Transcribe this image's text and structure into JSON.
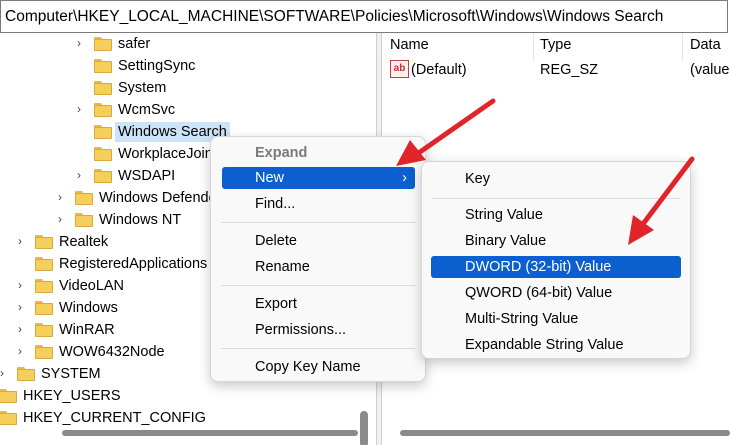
{
  "address_bar": {
    "path": "Computer\\HKEY_LOCAL_MACHINE\\SOFTWARE\\Policies\\Microsoft\\Windows\\Windows Search"
  },
  "tree": {
    "items": [
      {
        "label": "safer",
        "expandable": true,
        "selected": false
      },
      {
        "label": "SettingSync",
        "expandable": false,
        "selected": false
      },
      {
        "label": "System",
        "expandable": false,
        "selected": false
      },
      {
        "label": "WcmSvc",
        "expandable": true,
        "selected": false
      },
      {
        "label": "Windows Search",
        "expandable": false,
        "selected": true
      },
      {
        "label": "WorkplaceJoin",
        "expandable": false,
        "selected": false
      },
      {
        "label": "WSDAPI",
        "expandable": true,
        "selected": false
      },
      {
        "label": "Windows Defender",
        "expandable": true,
        "selected": false
      },
      {
        "label": "Windows NT",
        "expandable": true,
        "selected": false
      },
      {
        "label": "Realtek",
        "expandable": true,
        "selected": false
      },
      {
        "label": "RegisteredApplications",
        "expandable": false,
        "selected": false
      },
      {
        "label": "VideoLAN",
        "expandable": true,
        "selected": false
      },
      {
        "label": "Windows",
        "expandable": true,
        "selected": false
      },
      {
        "label": "WinRAR",
        "expandable": true,
        "selected": false
      },
      {
        "label": "WOW6432Node",
        "expandable": true,
        "selected": false
      },
      {
        "label": "SYSTEM",
        "expandable": true,
        "selected": false
      },
      {
        "label": "HKEY_USERS",
        "expandable": true,
        "selected": false
      },
      {
        "label": "HKEY_CURRENT_CONFIG",
        "expandable": true,
        "selected": false
      }
    ]
  },
  "values_pane": {
    "columns": [
      "Name",
      "Type",
      "Data"
    ],
    "rows": [
      {
        "name": "(Default)",
        "type": "REG_SZ",
        "data": "(value"
      }
    ]
  },
  "context_menu": {
    "items": [
      {
        "label": "Expand",
        "state": "disabled"
      },
      {
        "label": "New",
        "state": "highlighted",
        "submenu_arrow": "›"
      },
      {
        "label": "Find..."
      },
      {
        "label": "Delete"
      },
      {
        "label": "Rename"
      },
      {
        "label": "Export"
      },
      {
        "label": "Permissions..."
      },
      {
        "label": "Copy Key Name"
      }
    ]
  },
  "new_submenu": {
    "items": [
      {
        "label": "Key"
      },
      {
        "label": "String Value"
      },
      {
        "label": "Binary Value"
      },
      {
        "label": "DWORD (32-bit) Value",
        "state": "highlighted"
      },
      {
        "label": "QWORD (64-bit) Value"
      },
      {
        "label": "Multi-String Value"
      },
      {
        "label": "Expandable String Value"
      }
    ]
  },
  "colors": {
    "highlight": "#0b5fcf",
    "annotation_arrow": "#e0242a",
    "folder": "#f5cf5c",
    "tree_selection": "#cce4f7"
  }
}
